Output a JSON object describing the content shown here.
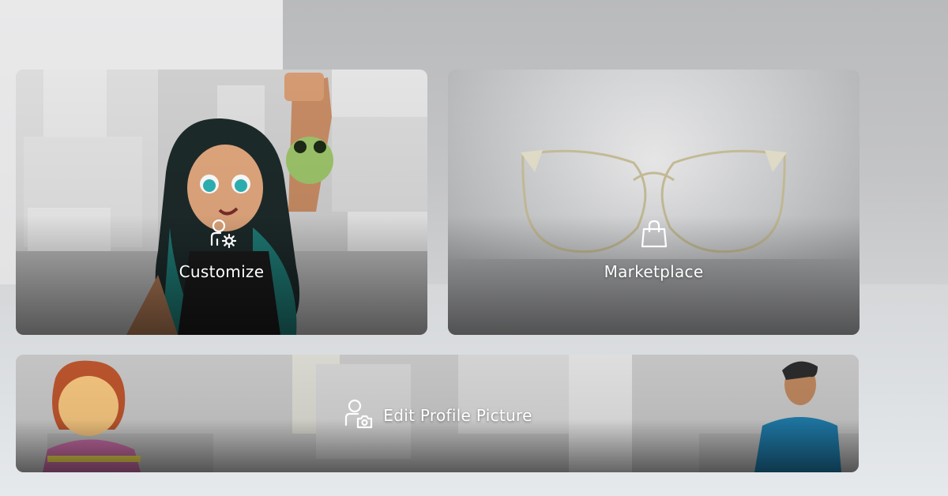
{
  "cards": {
    "customize": {
      "label": "Customize",
      "icon": "avatar-gear-icon"
    },
    "marketplace": {
      "label": "Marketplace",
      "icon": "shopping-bag-icon"
    },
    "profile_picture": {
      "label": "Edit Profile Picture",
      "icon": "avatar-camera-icon"
    }
  },
  "colors": {
    "label_text": "#ffffff",
    "card_shade": "#000000"
  }
}
